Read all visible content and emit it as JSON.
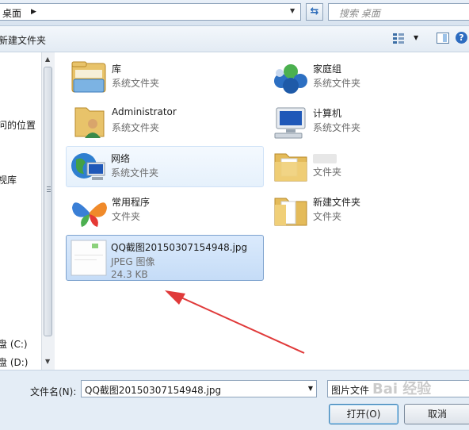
{
  "address_bar": {
    "location": "桌面"
  },
  "search": {
    "placeholder": "搜索 桌面"
  },
  "toolbar": {
    "new_folder_label": "新建文件夹",
    "help": "?"
  },
  "nav_pane": {
    "items": [
      {
        "label": "问的位置"
      },
      {
        "label": "视库"
      },
      {
        "label": "盘 (C:)"
      },
      {
        "label": "盘 (D:)"
      }
    ]
  },
  "items": [
    {
      "name": "库",
      "type": "系统文件夹",
      "icon": "library-icon"
    },
    {
      "name": "家庭组",
      "type": "系统文件夹",
      "icon": "homegroup-icon"
    },
    {
      "name": "Administrator",
      "type": "系统文件夹",
      "icon": "user-folder-icon"
    },
    {
      "name": "计算机",
      "type": "系统文件夹",
      "icon": "computer-icon"
    },
    {
      "name": "网络",
      "type": "系统文件夹",
      "icon": "network-icon"
    },
    {
      "name": "",
      "type": "文件夹",
      "icon": "folder-icon"
    },
    {
      "name": "常用程序",
      "type": "文件夹",
      "icon": "butterfly-icon"
    },
    {
      "name": "新建文件夹",
      "type": "文件夹",
      "icon": "folder-icon"
    },
    {
      "name": "QQ截图20150307154948.jpg",
      "type": "JPEG 图像",
      "size": "24.3 KB",
      "icon": "image-thumbnail-icon"
    }
  ],
  "file_name": {
    "label": "文件名(N):",
    "value": "QQ截图20150307154948.jpg"
  },
  "file_type": {
    "value": "图片文件"
  },
  "buttons": {
    "open": "打开(O)",
    "cancel": "取消"
  },
  "watermark": "Bai 经验",
  "colors": {
    "accent": "#3c7fb1",
    "selection": "#c5dcf7",
    "arrow": "#e03a3a"
  }
}
